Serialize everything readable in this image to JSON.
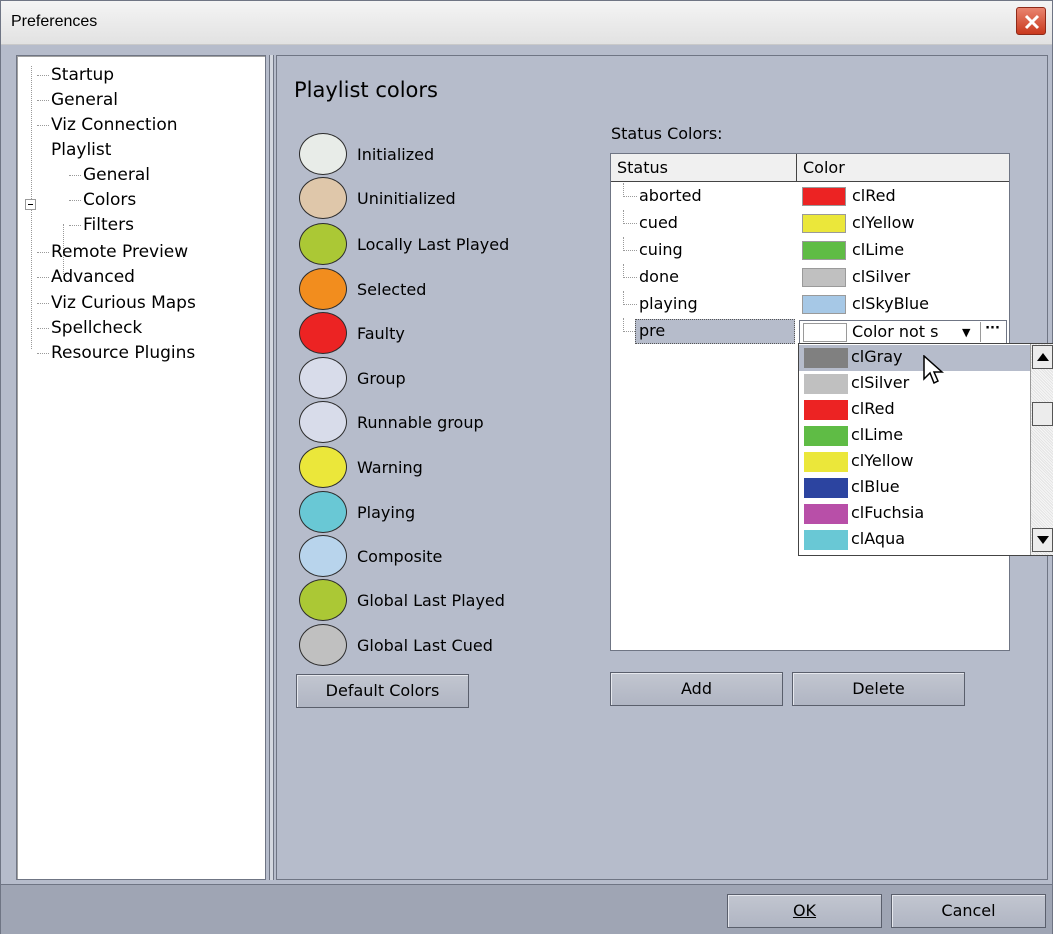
{
  "window": {
    "title": "Preferences"
  },
  "tree": {
    "items": [
      {
        "label": "Startup"
      },
      {
        "label": "General"
      },
      {
        "label": "Viz Connection"
      },
      {
        "label": "Playlist"
      },
      {
        "label": "General"
      },
      {
        "label": "Colors"
      },
      {
        "label": "Filters"
      },
      {
        "label": "Remote Preview"
      },
      {
        "label": "Advanced"
      },
      {
        "label": "Viz Curious Maps"
      },
      {
        "label": "Spellcheck"
      },
      {
        "label": "Resource Plugins"
      }
    ]
  },
  "main": {
    "title": "Playlist colors",
    "legend": [
      {
        "label": "Initialized",
        "color": "#e8ece8"
      },
      {
        "label": "Uninitialized",
        "color": "#dfc7aa"
      },
      {
        "label": "Locally Last Played",
        "color": "#abc835"
      },
      {
        "label": "Selected",
        "color": "#f28d1e"
      },
      {
        "label": "Faulty",
        "color": "#ec2323"
      },
      {
        "label": "Group",
        "color": "#d8dcea"
      },
      {
        "label": "Runnable group",
        "color": "#d8dcea"
      },
      {
        "label": "Warning",
        "color": "#ebe73a"
      },
      {
        "label": "Playing",
        "color": "#69c8d5"
      },
      {
        "label": "Composite",
        "color": "#b8d4ec"
      },
      {
        "label": "Global Last Played",
        "color": "#abc835"
      },
      {
        "label": "Global Last Cued",
        "color": "#c0c0c0"
      }
    ],
    "default_colors_label": "Default Colors",
    "status_colors_label": "Status Colors:",
    "grid": {
      "headers": {
        "status": "Status",
        "color": "Color"
      },
      "rows": [
        {
          "status": "aborted",
          "color_name": "clRed",
          "color": "#ec2323"
        },
        {
          "status": "cued",
          "color_name": "clYellow",
          "color": "#ebe73a"
        },
        {
          "status": "cuing",
          "color_name": "clLime",
          "color": "#5fbc45"
        },
        {
          "status": "done",
          "color_name": "clSilver",
          "color": "#c0c0c0"
        },
        {
          "status": "playing",
          "color_name": "clSkyBlue",
          "color": "#a6c8e6"
        }
      ],
      "edit_row": {
        "status": "pre",
        "color_text": "Color not s",
        "color": "#ffffff"
      }
    },
    "dropdown": {
      "options": [
        {
          "label": "clGray",
          "color": "#808080",
          "highlighted": true
        },
        {
          "label": "clSilver",
          "color": "#c0c0c0"
        },
        {
          "label": "clRed",
          "color": "#ec2323"
        },
        {
          "label": "clLime",
          "color": "#5fbc45"
        },
        {
          "label": "clYellow",
          "color": "#ebe73a"
        },
        {
          "label": "clBlue",
          "color": "#2c44a0"
        },
        {
          "label": "clFuchsia",
          "color": "#b84fa8"
        },
        {
          "label": "clAqua",
          "color": "#69c8d5"
        }
      ]
    },
    "add_label": "Add",
    "delete_label": "Delete"
  },
  "footer": {
    "ok_label": "OK",
    "cancel_label": "Cancel"
  }
}
